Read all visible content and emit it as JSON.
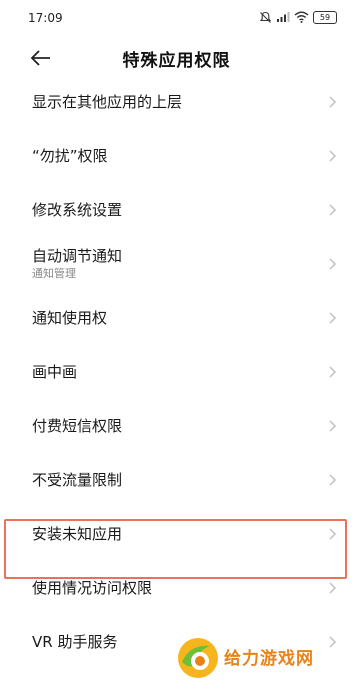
{
  "status_bar": {
    "time": "17:09",
    "battery": "59"
  },
  "header": {
    "title": "特殊应用权限",
    "back_icon": "arrow-left-icon"
  },
  "list": {
    "items": [
      {
        "label": "显示在其他应用的上层"
      },
      {
        "label": "“勿扰”权限"
      },
      {
        "label": "修改系统设置"
      },
      {
        "label": "自动调节通知",
        "sub": "通知管理"
      },
      {
        "label": "通知使用权"
      },
      {
        "label": "画中画"
      },
      {
        "label": "付费短信权限"
      },
      {
        "label": "不受流量限制"
      },
      {
        "label": "安装未知应用"
      },
      {
        "label": "使用情况访问权限"
      },
      {
        "label": "VR 助手服务"
      }
    ]
  },
  "colors": {
    "highlight": "#e8735a",
    "watermark_text": "#e8831a",
    "chevron": "#bdbdbd"
  },
  "watermark": {
    "text": "给力游戏网"
  }
}
